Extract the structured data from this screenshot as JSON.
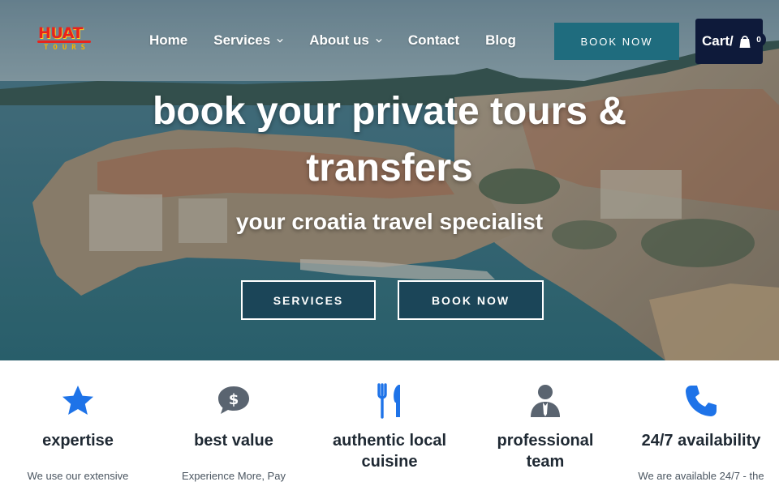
{
  "logo": {
    "main": "HUAT",
    "sub": "TOURS"
  },
  "nav": {
    "items": [
      {
        "label": "Home"
      },
      {
        "label": "Services"
      },
      {
        "label": "About us"
      },
      {
        "label": "Contact"
      },
      {
        "label": "Blog"
      }
    ],
    "book_now": "BOOK NOW",
    "cart_label": "Cart/",
    "cart_count": "0"
  },
  "hero": {
    "title_line1": "book your private tours &",
    "title_line2": "transfers",
    "subtitle": "your croatia travel specialist",
    "btn_services": "SERVICES",
    "btn_book": "BOOK NOW"
  },
  "features": [
    {
      "icon": "star-icon",
      "title": "expertise",
      "desc": "We use our extensive"
    },
    {
      "icon": "money-chat-icon",
      "title": "best value",
      "desc": "Experience More, Pay"
    },
    {
      "icon": "fork-knife-icon",
      "title_line1": "authentic local",
      "title_line2": "cuisine"
    },
    {
      "icon": "businessman-icon",
      "title_line1": "professional",
      "title_line2": "team"
    },
    {
      "icon": "phone-icon",
      "title": "24/7 availability",
      "desc": "We are available 24/7 - the"
    }
  ],
  "colors": {
    "accent": "#1f6c7e",
    "cart_bg": "#0e1a3a",
    "icon_blue": "#1e73e8",
    "icon_grey": "#5a6470"
  }
}
